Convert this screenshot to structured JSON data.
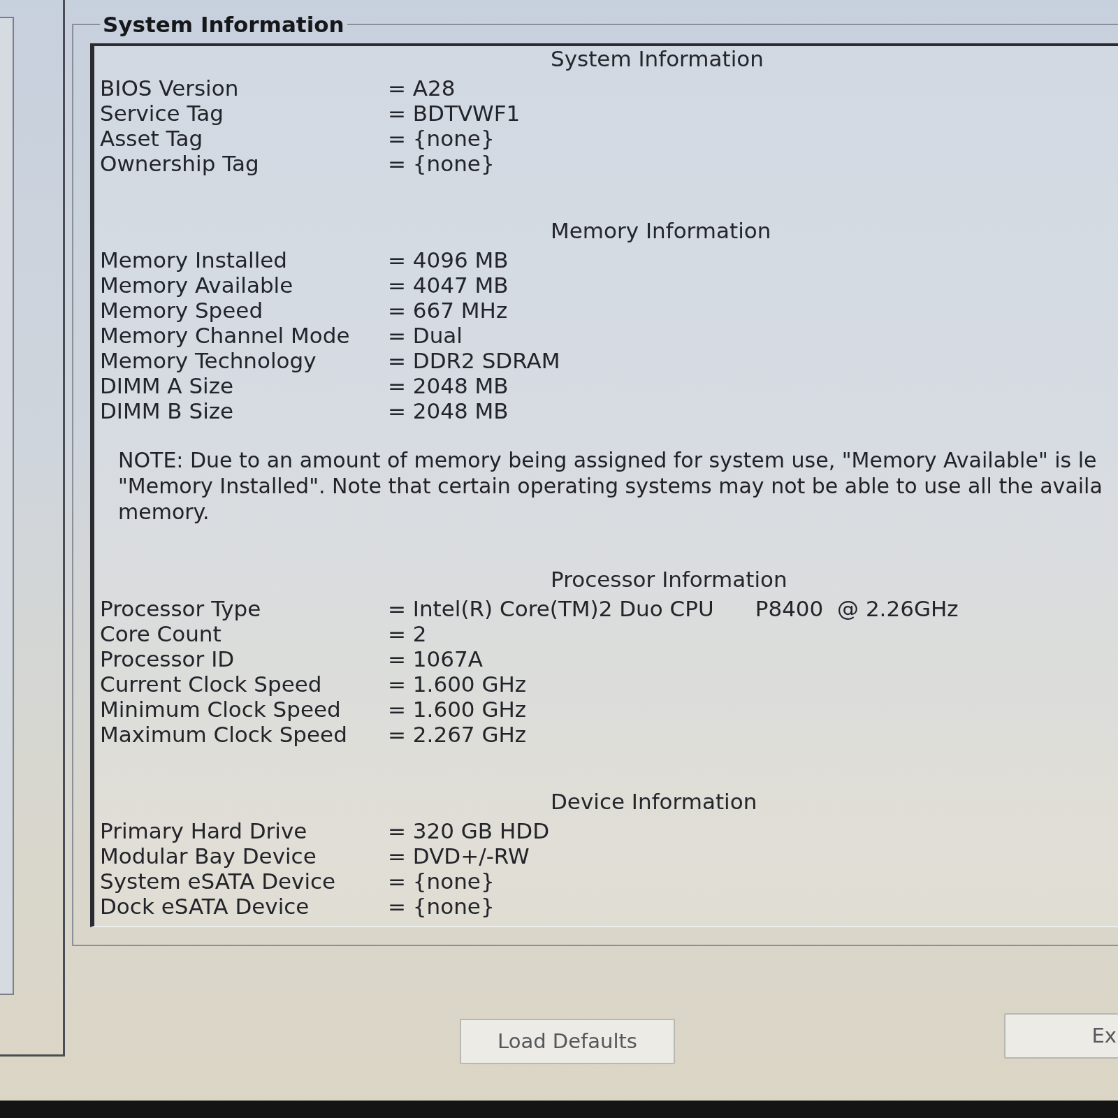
{
  "group_box": {
    "title": "System Information"
  },
  "sections": [
    {
      "heading": "System Information",
      "rows": [
        {
          "label": "BIOS Version",
          "value": "= A28"
        },
        {
          "label": "Service Tag",
          "value": "= BDTVWF1"
        },
        {
          "label": "Asset Tag",
          "value": "= {none}"
        },
        {
          "label": "Ownership Tag",
          "value": "= {none}"
        }
      ]
    },
    {
      "heading": "Memory Information",
      "rows": [
        {
          "label": "Memory Installed",
          "value": "= 4096 MB"
        },
        {
          "label": "Memory Available",
          "value": "= 4047 MB"
        },
        {
          "label": "Memory Speed",
          "value": "= 667 MHz"
        },
        {
          "label": "Memory Channel Mode",
          "value": "= Dual"
        },
        {
          "label": "Memory Technology",
          "value": "= DDR2 SDRAM"
        },
        {
          "label": "DIMM A Size",
          "value": "= 2048 MB"
        },
        {
          "label": "DIMM B Size",
          "value": "= 2048 MB"
        }
      ],
      "note": {
        "lines": [
          "NOTE: Due to an amount of memory being assigned for system use, \"Memory Available\" is le",
          "\"Memory Installed\". Note that certain operating systems may not be able to use all the availa",
          "memory."
        ]
      }
    },
    {
      "heading": "Processor Information",
      "rows": [
        {
          "label": "Processor Type",
          "value": "= Intel(R) Core(TM)2 Duo CPU      P8400  @ 2.26GHz"
        },
        {
          "label": "Core Count",
          "value": "= 2"
        },
        {
          "label": "Processor ID",
          "value": "= 1067A"
        },
        {
          "label": "Current Clock Speed",
          "value": "= 1.600 GHz"
        },
        {
          "label": "Minimum Clock Speed",
          "value": "= 1.600 GHz"
        },
        {
          "label": "Maximum Clock Speed",
          "value": "= 2.267 GHz"
        }
      ]
    },
    {
      "heading": "Device Information",
      "rows": [
        {
          "label": "Primary Hard Drive",
          "value": "= 320 GB HDD"
        },
        {
          "label": "Modular Bay Device",
          "value": "= DVD+/-RW"
        },
        {
          "label": "System eSATA Device",
          "value": "= {none}"
        },
        {
          "label": "Dock eSATA Device",
          "value": "= {none}"
        }
      ]
    }
  ],
  "buttons": [
    {
      "label": "Load Defaults"
    },
    {
      "label": "Ex"
    }
  ]
}
